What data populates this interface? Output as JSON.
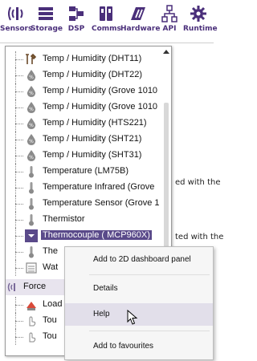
{
  "toolbar": {
    "items": [
      {
        "label": "Sensors",
        "icon": "sensor-wave-icon"
      },
      {
        "label": "Storage",
        "icon": "storage-icon"
      },
      {
        "label": "DSP",
        "icon": "dsp-icon"
      },
      {
        "label": "Comms",
        "icon": "comms-icon"
      },
      {
        "label": "Hardware",
        "icon": "hardware-icon"
      },
      {
        "label": "API",
        "icon": "api-icon"
      },
      {
        "label": "Runtime",
        "icon": "runtime-gear-icon"
      }
    ],
    "accent": "#4a2f7a"
  },
  "background": {
    "line1": "ed with the",
    "line2": "ted with the"
  },
  "tree": {
    "items": [
      {
        "label": "Temp / Humidity (DHT11)",
        "icon": "tools-icon"
      },
      {
        "label": "Temp / Humidity (DHT22)",
        "icon": "humidity-drop-icon"
      },
      {
        "label": "Temp / Humidity (Grove 1010",
        "icon": "humidity-drop-icon"
      },
      {
        "label": "Temp / Humidity (Grove 1010",
        "icon": "humidity-drop-icon"
      },
      {
        "label": "Temp / Humidity (HTS221)",
        "icon": "humidity-drop-icon"
      },
      {
        "label": "Temp / Humidity (SHT21)",
        "icon": "humidity-drop-icon"
      },
      {
        "label": "Temp / Humidity (SHT31)",
        "icon": "humidity-drop-icon"
      },
      {
        "label": "Temperature (LM75B)",
        "icon": "thermometer-icon"
      },
      {
        "label": "Temperature Infrared (Grove",
        "icon": "thermometer-icon"
      },
      {
        "label": "Temperature Sensor (Grove 1",
        "icon": "thermometer-icon"
      },
      {
        "label": "Thermistor",
        "icon": "thermometer-icon"
      },
      {
        "label": "Thermocouple ( MCP960X)",
        "icon": "thermometer-icon",
        "selected": true
      },
      {
        "label": "The",
        "icon": "thermometer-icon"
      },
      {
        "label": "Wat",
        "icon": "water-level-icon"
      }
    ],
    "group": {
      "label": "Force",
      "icon": "force-wave-icon"
    },
    "group_items": [
      {
        "label": "Load",
        "icon": "load-cell-icon"
      },
      {
        "label": "Tou",
        "icon": "touch-icon"
      },
      {
        "label": "Tou",
        "icon": "touch-icon"
      }
    ],
    "selection_color": "#5a4a8a"
  },
  "context_menu": {
    "items": [
      {
        "label": "Add to 2D dashboard panel"
      },
      {
        "label": "Details"
      },
      {
        "label": "Help",
        "hover": true
      },
      {
        "label": "Add to favourites"
      }
    ]
  }
}
